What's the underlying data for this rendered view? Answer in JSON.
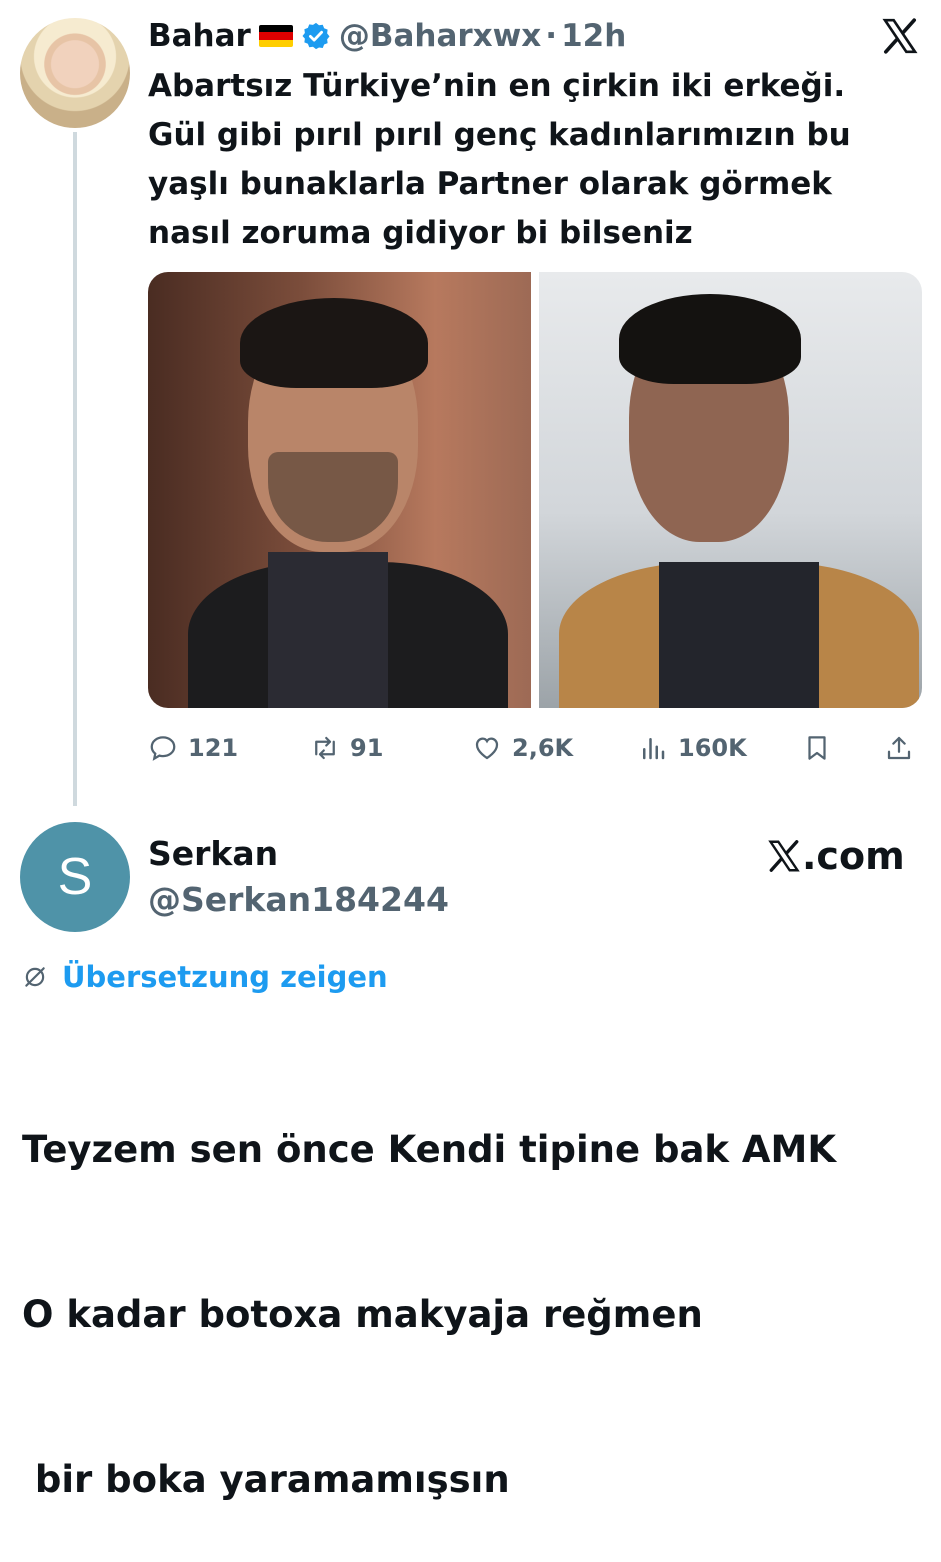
{
  "tweet": {
    "author_name": "Bahar",
    "flag_icon": "germany-flag",
    "verified_icon": "verified-badge-icon",
    "handle": "@Baharxwx",
    "separator": "·",
    "time": "12h",
    "text_lines": [
      "Abartsız Türkiye’nin en çirkin iki erkeği.",
      "Gül gibi pırıl pırıl genç kadınlarımızın bu",
      "yaşlı bunaklarla Partner olarak görmek",
      "nasıl zoruma gidiyor bi bilseniz"
    ],
    "stats": {
      "replies": "121",
      "retweets": "91",
      "likes": "2,6K",
      "views": "160K"
    }
  },
  "reply": {
    "avatar_letter": "S",
    "author_name": "Serkan",
    "handle": "@Serkan184244",
    "brand": ".com",
    "translate_label": "Übersetzung zeigen",
    "text_lines": [
      "Teyzem sen önce Kendi tipine bak AMK",
      "O kadar botoxa makyaja reğmen",
      " bir boka yaramamışsın"
    ]
  },
  "colors": {
    "accent": "#1d9bf0",
    "muted": "#536471",
    "text": "#0f1419",
    "reply_avatar": "#4f93a8"
  }
}
